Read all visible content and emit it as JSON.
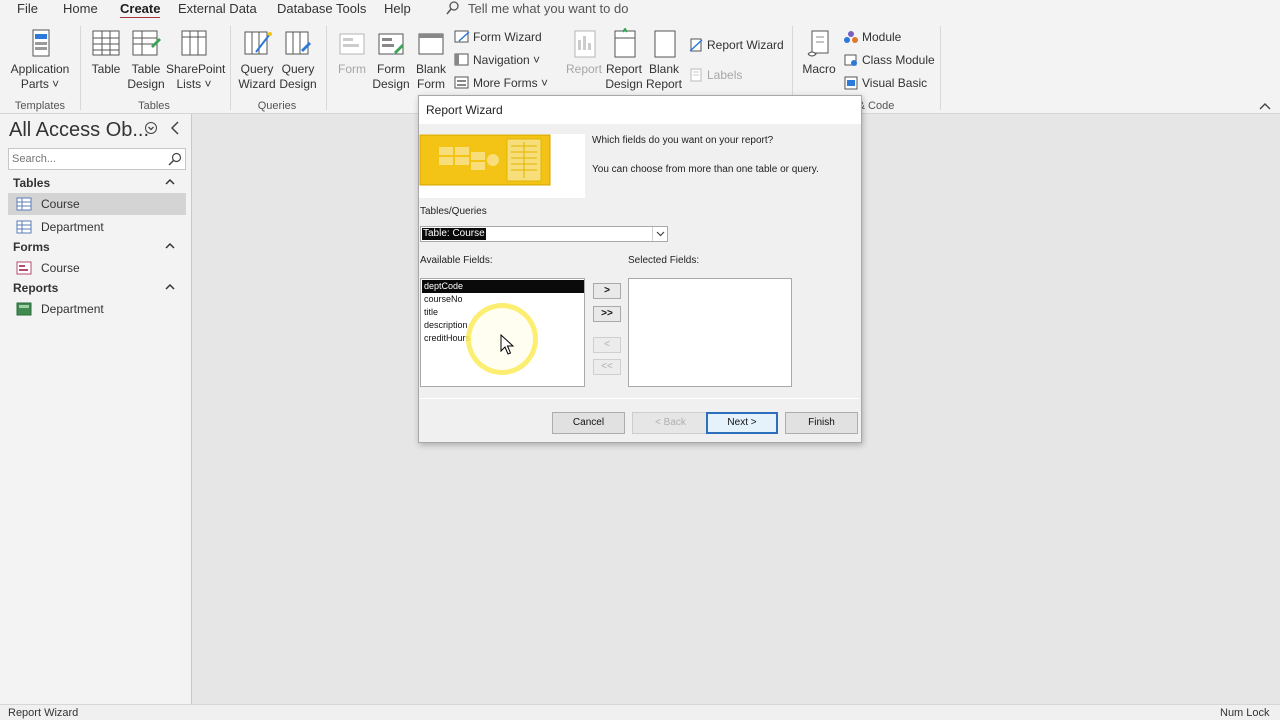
{
  "menubar": {
    "items": [
      "File",
      "Home",
      "Create",
      "External Data",
      "Database Tools",
      "Help"
    ],
    "active": "Create",
    "tellme": "Tell me what you want to do"
  },
  "ribbon": {
    "groups": {
      "templates": "Templates",
      "tables": "Tables",
      "queries": "Queries",
      "code": "& Code"
    },
    "buttons": {
      "application_parts": [
        "Application",
        "Parts ˅"
      ],
      "table": "Table",
      "table_design": [
        "Table",
        "Design"
      ],
      "sharepoint_lists": [
        "SharePoint",
        "Lists ˅"
      ],
      "query_wizard": [
        "Query",
        "Wizard"
      ],
      "query_design": [
        "Query",
        "Design"
      ],
      "form": "Form",
      "form_design": [
        "Form",
        "Design"
      ],
      "blank_form": [
        "Blank",
        "Form"
      ],
      "form_wizard": "Form Wizard",
      "navigation": "Navigation ˅",
      "more_forms": "More Forms ˅",
      "report": "Report",
      "report_design": [
        "Report",
        "Design"
      ],
      "blank_report": [
        "Blank",
        "Report"
      ],
      "report_wizard": "Report Wizard",
      "labels": "Labels",
      "macro": "Macro",
      "module": "Module",
      "class_module": "Class Module",
      "visual_basic": "Visual Basic"
    }
  },
  "navpane": {
    "title": "All Access Ob...",
    "search_placeholder": "Search...",
    "groups": [
      {
        "label": "Tables",
        "items": [
          "Course",
          "Department"
        ]
      },
      {
        "label": "Forms",
        "items": [
          "Course"
        ]
      },
      {
        "label": "Reports",
        "items": [
          "Department"
        ]
      }
    ],
    "selected": "Course"
  },
  "dialog": {
    "title": "Report Wizard",
    "question": "Which fields do you want on your report?",
    "hint": "You can choose from more than one table or query.",
    "tables_label": "Tables/Queries",
    "tables_value": "Table: Course",
    "available_label": "Available Fields:",
    "selected_label": "Selected Fields:",
    "available_fields": [
      "deptCode",
      "courseNo",
      "title",
      "description",
      "creditHours"
    ],
    "selected_fields": [],
    "move_buttons": [
      ">",
      ">>",
      "<",
      "<<"
    ],
    "buttons": {
      "cancel": "Cancel",
      "back": "< Back",
      "next": "Next >",
      "finish": "Finish"
    }
  },
  "statusbar": {
    "left": "Report Wizard",
    "right": "Num Lock"
  },
  "colors": {
    "accent": "#a4373a",
    "default_button_border": "#2d6fbd",
    "wizard_art": "#f3c316"
  }
}
